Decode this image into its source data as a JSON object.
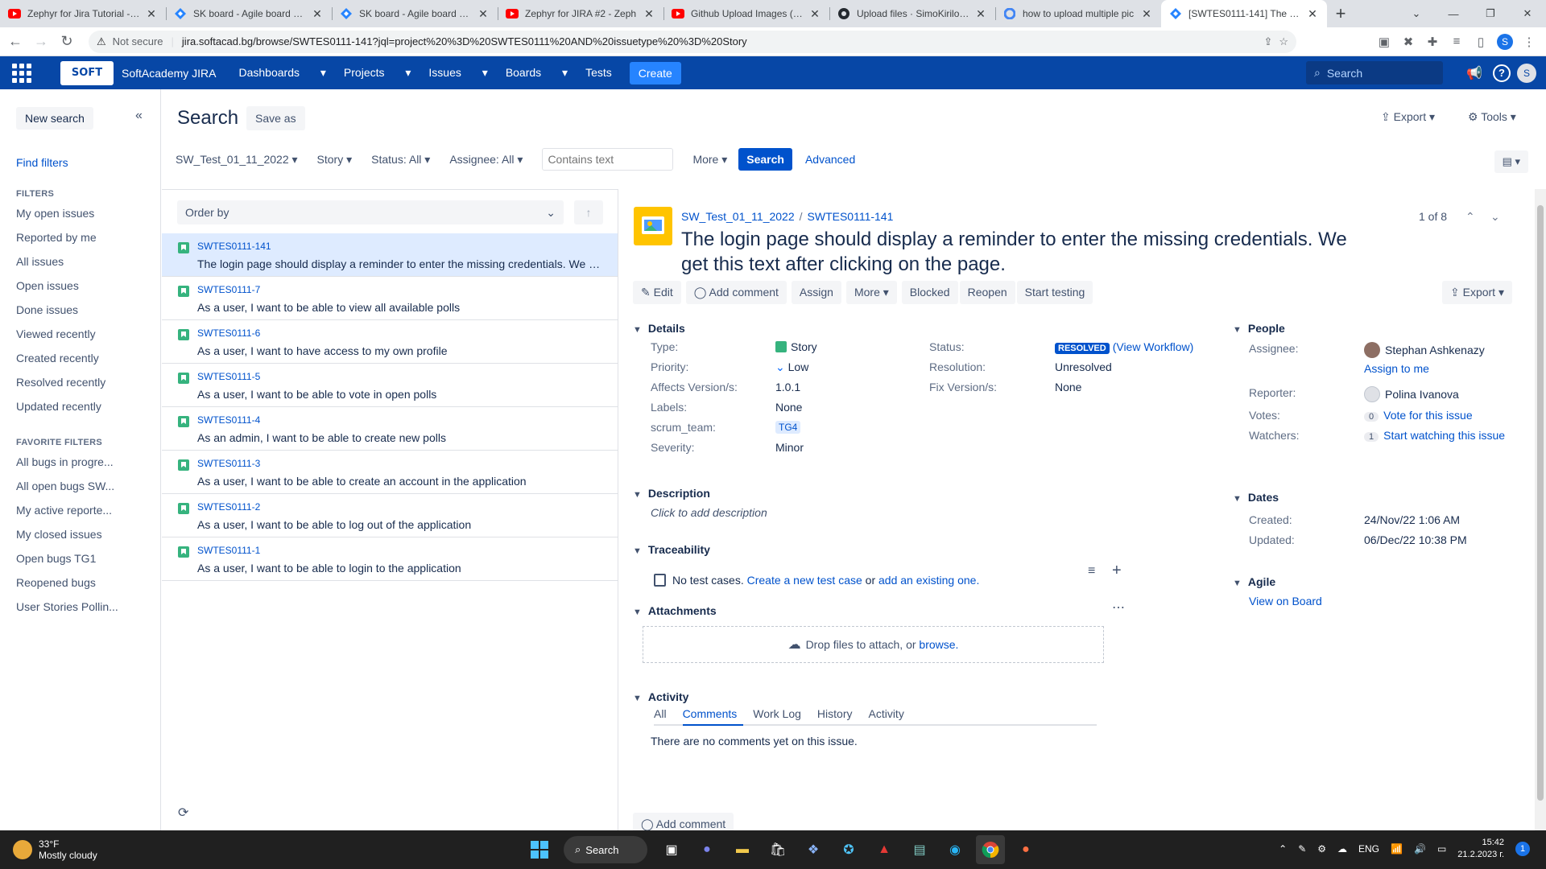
{
  "browser": {
    "tabs": [
      {
        "title": "Zephyr for Jira Tutorial - Te",
        "icon": "youtube-icon",
        "color": "#ff0000"
      },
      {
        "title": "SK board - Agile board - Ji",
        "icon": "jira-icon",
        "color": "#2684ff"
      },
      {
        "title": "SK board - Agile board - Ji",
        "icon": "jira-icon",
        "color": "#2684ff"
      },
      {
        "title": "Zephyr for JIRA #2 - Zeph",
        "icon": "youtube-icon",
        "color": "#ff0000"
      },
      {
        "title": "Github Upload Images (20",
        "icon": "youtube-icon",
        "color": "#ff0000"
      },
      {
        "title": "Upload files · SimoKirilov/f",
        "icon": "github-icon",
        "color": "#24292f"
      },
      {
        "title": "how to upload multiple pic",
        "icon": "google-icon",
        "color": "#4285f4"
      },
      {
        "title": "[SWTES0111-141] The logi",
        "icon": "jira-icon",
        "color": "#2684ff"
      }
    ],
    "not_secure": "Not secure",
    "url": "jira.softacad.bg/browse/SWTES0111-141?jql=project%20%3D%20SWTES0111%20AND%20issuetype%20%3D%20Story"
  },
  "jira_header": {
    "logo_text": "SOFT",
    "brand": "SoftAcademy JIRA",
    "menu": [
      "Dashboards",
      "Projects",
      "Issues",
      "Boards"
    ],
    "tests": "Tests",
    "create": "Create",
    "search_placeholder": "Search",
    "avatar_letter": "S"
  },
  "sidebar": {
    "new_search": "New search",
    "find_filters": "Find filters",
    "filters_heading": "FILTERS",
    "filters": [
      "My open issues",
      "Reported by me",
      "All issues",
      "Open issues",
      "Done issues",
      "Viewed recently",
      "Created recently",
      "Resolved recently",
      "Updated recently"
    ],
    "favorite_heading": "FAVORITE FILTERS",
    "favorites": [
      "All bugs in progre...",
      "All open bugs SW...",
      "My active reporte...",
      "My closed issues",
      "Open bugs TG1",
      "Reopened bugs",
      "User Stories Pollin..."
    ]
  },
  "search_header": {
    "title": "Search",
    "save_as": "Save as",
    "export": "Export",
    "tools": "Tools"
  },
  "filter_bar": {
    "project": "SW_Test_01_11_2022",
    "type": "Story",
    "status": "Status: All",
    "assignee": "Assignee: All",
    "text_placeholder": "Contains text",
    "more": "More",
    "search": "Search",
    "advanced": "Advanced"
  },
  "list": {
    "order_by": "Order by",
    "issues": [
      {
        "key": "SWTES0111-141",
        "summary": "The login page should display a reminder to enter the missing credentials. We get this text after clicking on the page."
      },
      {
        "key": "SWTES0111-7",
        "summary": "As a user, I want to be able to view all available polls"
      },
      {
        "key": "SWTES0111-6",
        "summary": "As a user, I want to have access to my own profile"
      },
      {
        "key": "SWTES0111-5",
        "summary": "As a user, I want to be able to vote in open polls"
      },
      {
        "key": "SWTES0111-4",
        "summary": "As an admin, I want to be able to create new polls"
      },
      {
        "key": "SWTES0111-3",
        "summary": "As a user, I want to be able to create an account in the application"
      },
      {
        "key": "SWTES0111-2",
        "summary": "As a user, I want to be able to log out of the application"
      },
      {
        "key": "SWTES0111-1",
        "summary": "As a user, I want to be able to login to the application"
      }
    ]
  },
  "issue": {
    "project": "SW_Test_01_11_2022",
    "key": "SWTES0111-141",
    "summary": "The login page should display a reminder to enter the missing credentials. We get this text after clicking on the page.",
    "pager": "1 of 8",
    "ops": [
      "Edit",
      "Add comment",
      "Assign",
      "More",
      "Blocked",
      "Reopen",
      "Start testing"
    ],
    "export": "Export",
    "details_heading": "Details",
    "type_label": "Type:",
    "type_value": "Story",
    "priority_label": "Priority:",
    "priority_value": "Low",
    "affects_label": "Affects Version/s:",
    "affects_value": "1.0.1",
    "labels_label": "Labels:",
    "labels_value": "None",
    "scrum_label": "scrum_team:",
    "scrum_value": "TG4",
    "severity_label": "Severity:",
    "severity_value": "Minor",
    "status_label": "Status:",
    "status_value": "RESOLVED",
    "view_workflow": "(View Workflow)",
    "resolution_label": "Resolution:",
    "resolution_value": "Unresolved",
    "fix_label": "Fix Version/s:",
    "fix_value": "None",
    "description_heading": "Description",
    "description_placeholder": "Click to add description",
    "traceability_heading": "Traceability",
    "no_test_cases": "No test cases.",
    "create_test_case": "Create a new test case",
    "or": "or",
    "add_existing": "add an existing one.",
    "attachments_heading": "Attachments",
    "drop_files": "Drop files to attach, or",
    "browse": "browse.",
    "activity_heading": "Activity",
    "activity_tabs": [
      "All",
      "Comments",
      "Work Log",
      "History",
      "Activity"
    ],
    "no_comments": "There are no comments yet on this issue.",
    "add_comment": "Add comment",
    "people_heading": "People",
    "assignee_label": "Assignee:",
    "assignee_value": "Stephan Ashkenazy",
    "assign_to_me": "Assign to me",
    "reporter_label": "Reporter:",
    "reporter_value": "Polina Ivanova",
    "votes_label": "Votes:",
    "votes_count": "0",
    "vote_link": "Vote for this issue",
    "watchers_label": "Watchers:",
    "watchers_count": "1",
    "watch_link": "Start watching this issue",
    "dates_heading": "Dates",
    "created_label": "Created:",
    "created_value": "24/Nov/22 1:06 AM",
    "updated_label": "Updated:",
    "updated_value": "06/Dec/22 10:38 PM",
    "agile_heading": "Agile",
    "view_on_board": "View on Board"
  },
  "taskbar": {
    "temp": "33°F",
    "weather": "Mostly cloudy",
    "search": "Search",
    "lang": "ENG",
    "time": "15:42",
    "date": "21.2.2023 г.",
    "notif": "1"
  }
}
